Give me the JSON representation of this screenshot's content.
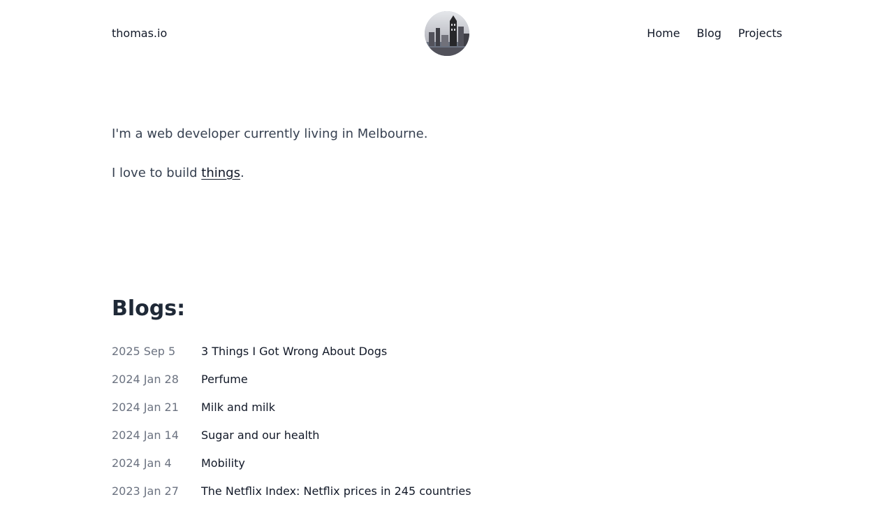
{
  "header": {
    "site_name": "thomas.io",
    "nav": [
      {
        "label": "Home"
      },
      {
        "label": "Blog"
      },
      {
        "label": "Projects"
      }
    ]
  },
  "intro": {
    "line1": "I'm a web developer currently living in Melbourne.",
    "line2_prefix": "I love to build ",
    "line2_link": "things",
    "line2_suffix": "."
  },
  "blogs": {
    "heading": "Blogs:",
    "posts": [
      {
        "date": "2025 Sep 5",
        "title": "3 Things I Got Wrong About Dogs"
      },
      {
        "date": "2024 Jan 28",
        "title": "Perfume"
      },
      {
        "date": "2024 Jan 21",
        "title": "Milk and milk"
      },
      {
        "date": "2024 Jan 14",
        "title": "Sugar and our health"
      },
      {
        "date": "2024 Jan 4",
        "title": "Mobility"
      },
      {
        "date": "2023 Jan 27",
        "title": "The Netflix Index: Netflix prices in 245 countries"
      }
    ]
  }
}
